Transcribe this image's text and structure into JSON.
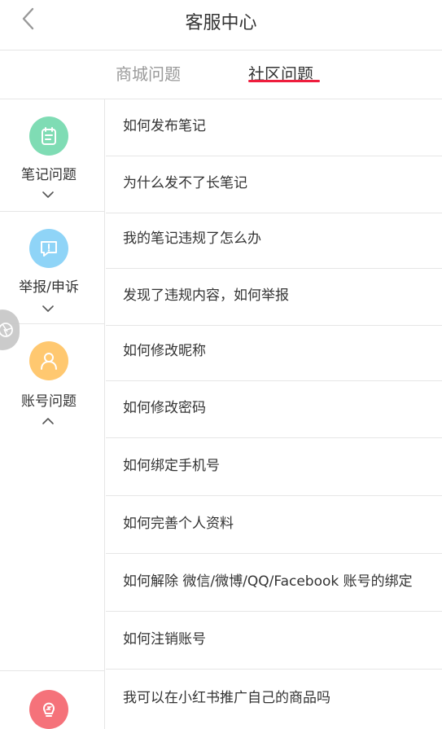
{
  "header": {
    "title": "客服中心"
  },
  "tabs": [
    {
      "label": "商城问题",
      "active": false
    },
    {
      "label": "社区问题",
      "active": true
    }
  ],
  "accent_color": "#ee1d3d",
  "sidebar": {
    "categories": [
      {
        "label": "笔记问题",
        "icon": "note-icon",
        "icon_color": "#7fdcb4",
        "chevron": "chevron-down-icon"
      },
      {
        "label": "举报/申诉",
        "icon": "report-icon",
        "icon_color": "#8fd4f7",
        "chevron": "chevron-down-icon"
      },
      {
        "label": "账号问题",
        "icon": "user-icon",
        "icon_color": "#ffc870",
        "chevron": "chevron-up-icon"
      },
      {
        "label": "",
        "icon": "bulb-icon",
        "icon_color": "#f5727a"
      }
    ]
  },
  "questions": [
    "如何发布笔记",
    "为什么发不了长笔记",
    "我的笔记违规了怎么办",
    "发现了违规内容，如何举报",
    "如何修改昵称",
    "如何修改密码",
    "如何绑定手机号",
    "如何完善个人资料",
    "如何解除 微信/微博/QQ/Facebook 账号的绑定",
    "如何注销账号",
    "我可以在小红书推广自己的商品吗"
  ]
}
